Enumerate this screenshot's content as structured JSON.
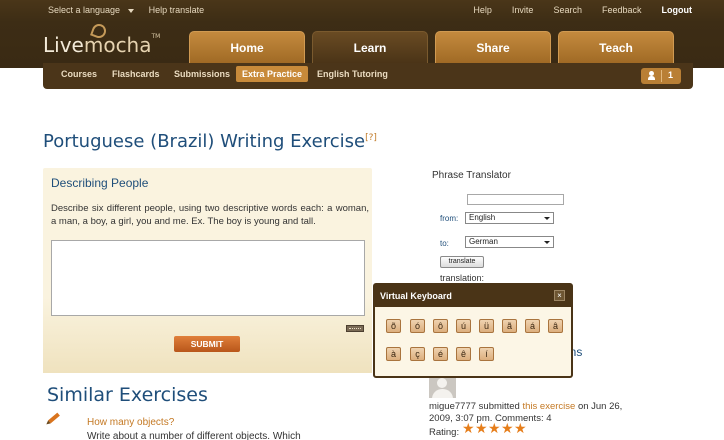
{
  "toplinks": {
    "language": "Select a language",
    "help_translate": "Help translate",
    "right": [
      "Help",
      "Invite",
      "Search",
      "Feedback"
    ],
    "logout": "Logout"
  },
  "logo": {
    "part1": "Live",
    "part2": "mocha",
    "tm": "TM"
  },
  "nav": {
    "tabs": [
      {
        "label": "Home"
      },
      {
        "label": "Learn",
        "active": true
      },
      {
        "label": "Share"
      },
      {
        "label": "Teach"
      }
    ]
  },
  "subnav": {
    "items": [
      "Courses",
      "Flashcards",
      "Submissions",
      "Extra Practice",
      "English Tutoring"
    ],
    "active": "Extra Practice",
    "notification_count": "1"
  },
  "page": {
    "title": "Portuguese (Brazil) Writing Exercise",
    "help": "[?]"
  },
  "exercise": {
    "heading": "Describing People",
    "description": "Describe six different people, using two descriptive words each: a woman, a man, a boy, a girl, you and me. Ex. The boy is young and tall.",
    "answer_value": "",
    "submit_label": "SUBMIT"
  },
  "similar": {
    "title": "Similar Exercises",
    "items": [
      {
        "title": "How many objects?",
        "desc": "Write about a number of different objects. Which"
      }
    ]
  },
  "translator": {
    "title": "Phrase Translator",
    "input_value": "",
    "from_label": "from:",
    "from_value": "English",
    "to_label": "to:",
    "to_value": "German",
    "button": "translate",
    "translation_label": "translation:"
  },
  "recent": {
    "title_visible": "ons",
    "user": "migue7777",
    "submitted": "submitted",
    "link": "this exercise",
    "date_text": "on Jun 26,",
    "line2": "2009, 3:07 pm. Comments: 4",
    "rating_label": "Rating:",
    "rating_stars": 5
  },
  "virtual_keyboard": {
    "title": "Virtual Keyboard",
    "close": "×",
    "row1": [
      "õ",
      "ó",
      "ô",
      "ú",
      "ü",
      "ã",
      "á",
      "â"
    ],
    "row2": [
      "à",
      "ç",
      "é",
      "ê",
      "í"
    ]
  }
}
